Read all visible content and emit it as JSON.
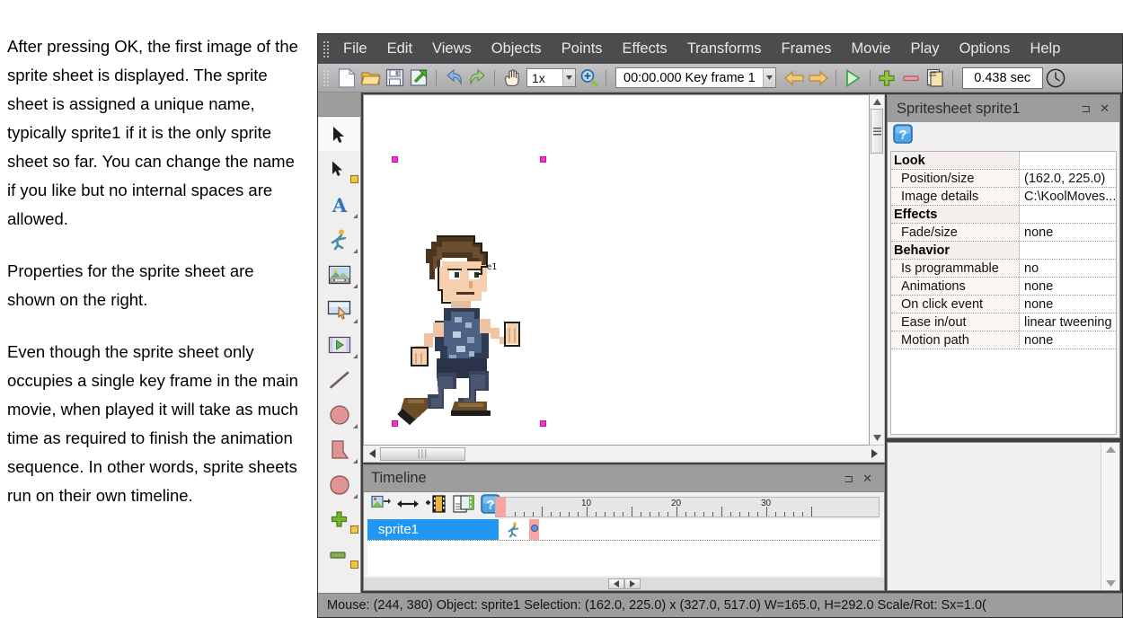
{
  "document_text": {
    "paragraphs": [
      "After pressing OK, the first image of the sprite sheet is displayed. The sprite sheet is assigned a unique name, typically sprite1 if it is the only sprite sheet so far. You can change the name if you like but no internal spaces are allowed.",
      "Properties for the sprite sheet are shown on the right.",
      "Even though the sprite sheet only occupies a single key frame in the main movie, when played it will take as much time as required to finish the animation sequence. In other words, sprite sheets run on their own timeline."
    ]
  },
  "menubar": {
    "items": [
      {
        "label": "File"
      },
      {
        "label": "Edit"
      },
      {
        "label": "Views"
      },
      {
        "label": "Objects"
      },
      {
        "label": "Points"
      },
      {
        "label": "Effects"
      },
      {
        "label": "Transforms"
      },
      {
        "label": "Frames"
      },
      {
        "label": "Movie"
      },
      {
        "label": "Play"
      },
      {
        "label": "Options"
      },
      {
        "label": "Help"
      }
    ]
  },
  "toolbar": {
    "buttons": [
      {
        "name": "new-document-icon"
      },
      {
        "name": "open-folder-icon"
      },
      {
        "name": "save-icon"
      },
      {
        "name": "export-icon"
      },
      {
        "name": "undo-icon"
      },
      {
        "name": "redo-icon"
      },
      {
        "name": "pan-hand-icon"
      }
    ],
    "zoom_value": "1x",
    "timecode": "00:00.000  Key frame 1",
    "duration": "0.438 sec",
    "nav_prev": "previous-frame-icon",
    "nav_next": "next-frame-icon",
    "play": "play-icon",
    "add_frame": "add-frame-icon",
    "remove_frame": "remove-frame-icon",
    "copy_frame": "copy-frame-icon",
    "clock": "clock-icon"
  },
  "toolpalette": {
    "tools": [
      {
        "name": "select-arrow-tool",
        "active": true
      },
      {
        "name": "subselect-arrow-tool",
        "active": false
      },
      {
        "name": "text-tool",
        "active": false
      },
      {
        "name": "figure-tool",
        "active": false
      },
      {
        "name": "image-tool",
        "active": false
      },
      {
        "name": "button-tool",
        "active": false
      },
      {
        "name": "movieclip-tool",
        "active": false
      },
      {
        "name": "line-tool",
        "active": false
      },
      {
        "name": "ellipse-tool",
        "active": false
      },
      {
        "name": "polygon-tool",
        "active": false
      },
      {
        "name": "blob-tool",
        "active": false
      },
      {
        "name": "add-point-tool",
        "active": false
      },
      {
        "name": "remove-segment-tool",
        "active": false
      }
    ]
  },
  "canvas": {
    "sprite_label": "sprite1"
  },
  "timeline_panel": {
    "title": "Timeline",
    "pin": "⊐",
    "close": "✕",
    "buttons": [
      {
        "name": "insert-object-icon"
      },
      {
        "name": "resize-arrows-icon"
      },
      {
        "name": "add-frame-icon"
      },
      {
        "name": "duplicate-frame-icon"
      },
      {
        "name": "help-icon"
      }
    ],
    "ruler_labels": [
      "10",
      "20",
      "30"
    ],
    "rows": [
      {
        "name": "sprite1",
        "icon": "figure-icon"
      }
    ]
  },
  "properties_panel": {
    "title": "Spritesheet sprite1",
    "pin": "⊐",
    "close": "✕",
    "help_button": "?",
    "rows": [
      {
        "group": true,
        "key": "Look",
        "value": ""
      },
      {
        "group": false,
        "key": "Position/size",
        "value": "(162.0, 225.0)"
      },
      {
        "group": false,
        "key": "Image details",
        "value": "C:\\KoolMoves..."
      },
      {
        "group": true,
        "key": "Effects",
        "value": ""
      },
      {
        "group": false,
        "key": "Fade/size",
        "value": "none"
      },
      {
        "group": true,
        "key": "Behavior",
        "value": ""
      },
      {
        "group": false,
        "key": "Is programmable",
        "value": "no"
      },
      {
        "group": false,
        "key": "Animations",
        "value": "none"
      },
      {
        "group": false,
        "key": "On click event",
        "value": "none"
      },
      {
        "group": false,
        "key": "Ease in/out",
        "value": "linear tweening"
      },
      {
        "group": false,
        "key": "Motion path",
        "value": "none"
      }
    ]
  },
  "statusbar": {
    "text": "Mouse: (244, 380)  Object: sprite1  Selection: (162.0, 225.0) x (327.0, 517.0)  W=165.0,  H=292.0  Scale/Rot: Sx=1.0("
  },
  "colors": {
    "menubar_bg": "#4c4c4e",
    "window_frame": "#3f3f41",
    "panel_title_bg": "#9d9d9d",
    "accent_selection": "#2196f3",
    "handle_pink": "#ff2bd6",
    "playhead_pink": "#f9a3a3"
  }
}
